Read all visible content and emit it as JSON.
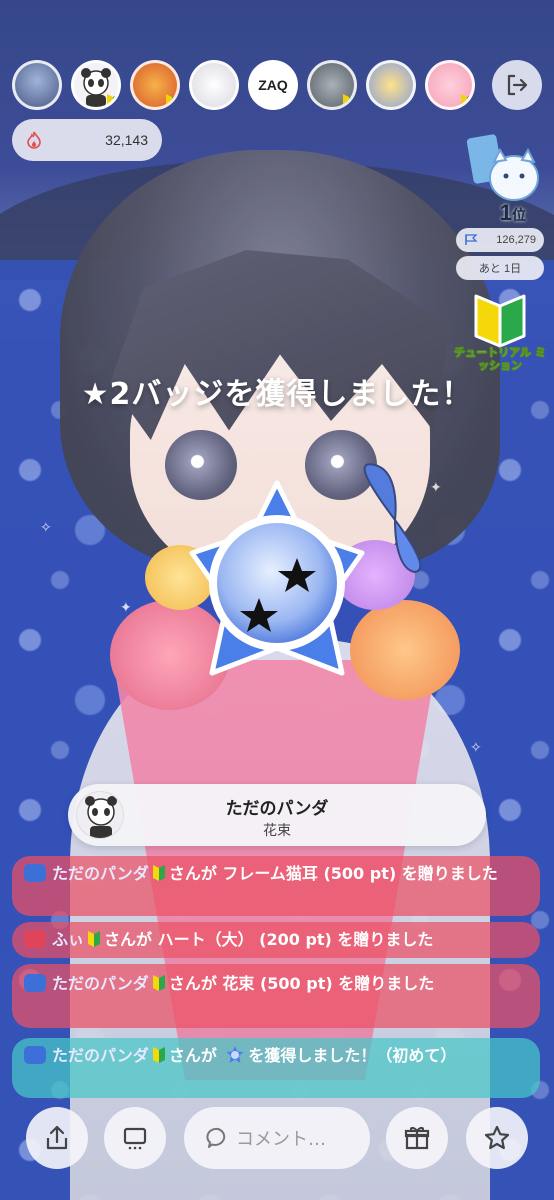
{
  "top_bar": {
    "viewer_avatars": [
      {
        "name": "viewer-avatar-1",
        "badge": false
      },
      {
        "name": "viewer-avatar-2",
        "badge": true
      },
      {
        "name": "viewer-avatar-3",
        "badge": true
      },
      {
        "name": "viewer-avatar-4",
        "badge": false
      },
      {
        "name": "viewer-avatar-5",
        "badge": false
      },
      {
        "name": "viewer-avatar-6",
        "badge": true
      },
      {
        "name": "viewer-avatar-7",
        "badge": false
      },
      {
        "name": "viewer-avatar-8",
        "badge": true
      }
    ],
    "avatar_5_text": "ZAQ",
    "exit_icon": "exit-icon"
  },
  "points": {
    "icon": "flame-icon",
    "value": "32,143"
  },
  "ranking": {
    "rank_number": "1",
    "rank_unit": "位",
    "pts_icon": "flag-icon",
    "pts_value": "126,279",
    "remaining": "あと 1日"
  },
  "tutorial": {
    "label": "チュートリアル ミッション"
  },
  "announcement": "★2バッジを獲得しました！",
  "gift_card": {
    "user": "ただのパンダ",
    "item": "花束"
  },
  "messages": [
    {
      "badge": "blue",
      "user": "ただのパンダ",
      "text": "さんが フレーム猫耳 (500 pt) を贈りました",
      "style": "red"
    },
    {
      "badge": "red",
      "user": "ふぃ",
      "text": "さんが ハート（大） (200 pt) を贈りました",
      "style": "red"
    },
    {
      "badge": "blue",
      "user": "ただのパンダ",
      "text": "さんが 花束 (500 pt) を贈りました",
      "style": "red"
    },
    {
      "badge": "blue",
      "user": "ただのパンダ",
      "text_before": "さんが",
      "text_after": "を獲得しました！（初めて）",
      "style": "teal"
    }
  ],
  "bottom_bar": {
    "share_icon": "share-icon",
    "screen_icon": "screen-icon",
    "comment_placeholder": "コメント…",
    "gift_icon": "gift-icon",
    "star_icon": "star-icon"
  },
  "colors": {
    "message_red": "#ec5064",
    "message_teal": "#46c8c8",
    "badge_blue": "#3d6fd8",
    "badge_red": "#e0445a",
    "star_badge_blue": "#4a7ee8"
  }
}
